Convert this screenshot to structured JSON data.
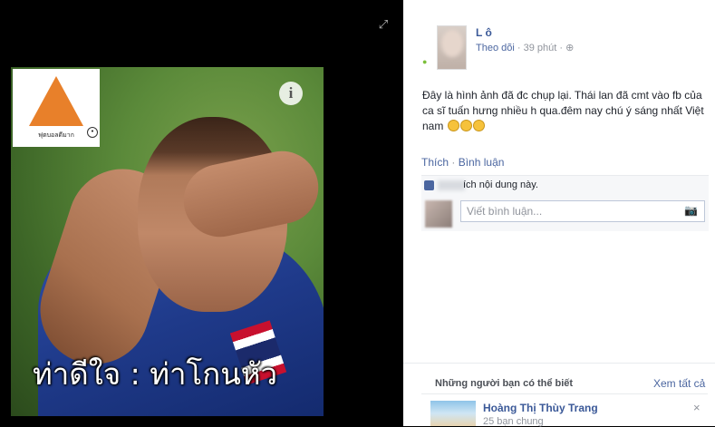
{
  "viewer": {
    "expand_icon": "expand-icon",
    "caption": "ท่าดีใจ : ท่าโกนหัว",
    "logo_text": "ฟุตบอลดีมาก",
    "info_icon": "i"
  },
  "post": {
    "poster_name": "L          ô",
    "follow_label": "Theo dõi",
    "time": "39 phút",
    "privacy_icon": "globe-icon",
    "text": "Đây là hình ảnh đã đc chụp lại. Thái lan đã cmt vào fb của ca sĩ tuấn hưng nhiều h qua.đêm nay chú ý sáng nhất Việt nam",
    "emoji_count": 3,
    "actions": {
      "like": "Thích",
      "separator": "·",
      "comment": "Bình luận"
    },
    "reactions_text": "ích nội dung này.",
    "comment_placeholder": "Viết bình luận..."
  },
  "pymk": {
    "title": "Những người bạn có thể biết",
    "see_all": "Xem tất cả",
    "friend_name": "Hoàng Thị Thùy Trang",
    "mutual": "25 bạn chung",
    "close": "×"
  },
  "colors": {
    "link": "#3b5998",
    "background": "#000000",
    "panel": "#ffffff"
  }
}
